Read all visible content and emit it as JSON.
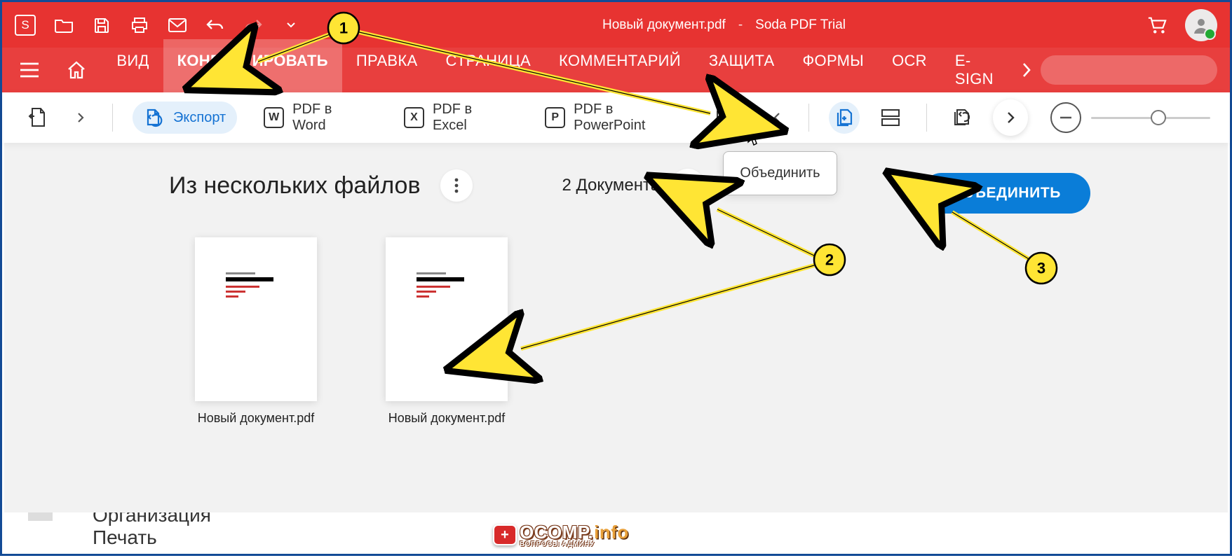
{
  "titlebar": {
    "doc_title": "Новый документ.pdf",
    "separator": "-",
    "app_name": "Soda PDF Trial"
  },
  "menu": {
    "tabs": [
      "ВИД",
      "КОНВЕРТИРОВАТЬ",
      "ПРАВКА",
      "СТРАНИЦА",
      "КОММЕНТАРИЙ",
      "ЗАЩИТА",
      "ФОРМЫ",
      "OCR",
      "E-SIGN"
    ],
    "active_index": 1
  },
  "subbar": {
    "export_label": "Экспорт",
    "tools": [
      {
        "icon": "W",
        "label": "PDF в Word"
      },
      {
        "icon": "X",
        "label": "PDF в Excel"
      },
      {
        "icon": "P",
        "label": "PDF в PowerPoint"
      }
    ],
    "tooltip": "Объединить"
  },
  "workarea": {
    "title": "Из нескольких файлов",
    "doc_count_label": "2 Документа",
    "merge_button": "ОБЪЕДИНИТЬ",
    "docs": [
      {
        "name": "Новый документ.pdf"
      },
      {
        "name": "Новый документ.pdf"
      }
    ]
  },
  "below": {
    "line1": "Организация",
    "line2": "Печать"
  },
  "watermark": {
    "main": "OCOMP.",
    "tld": "info",
    "sub": "ВОПРОСЫ АДМИНУ"
  },
  "annotations": {
    "markers": [
      "1",
      "2",
      "3"
    ]
  }
}
